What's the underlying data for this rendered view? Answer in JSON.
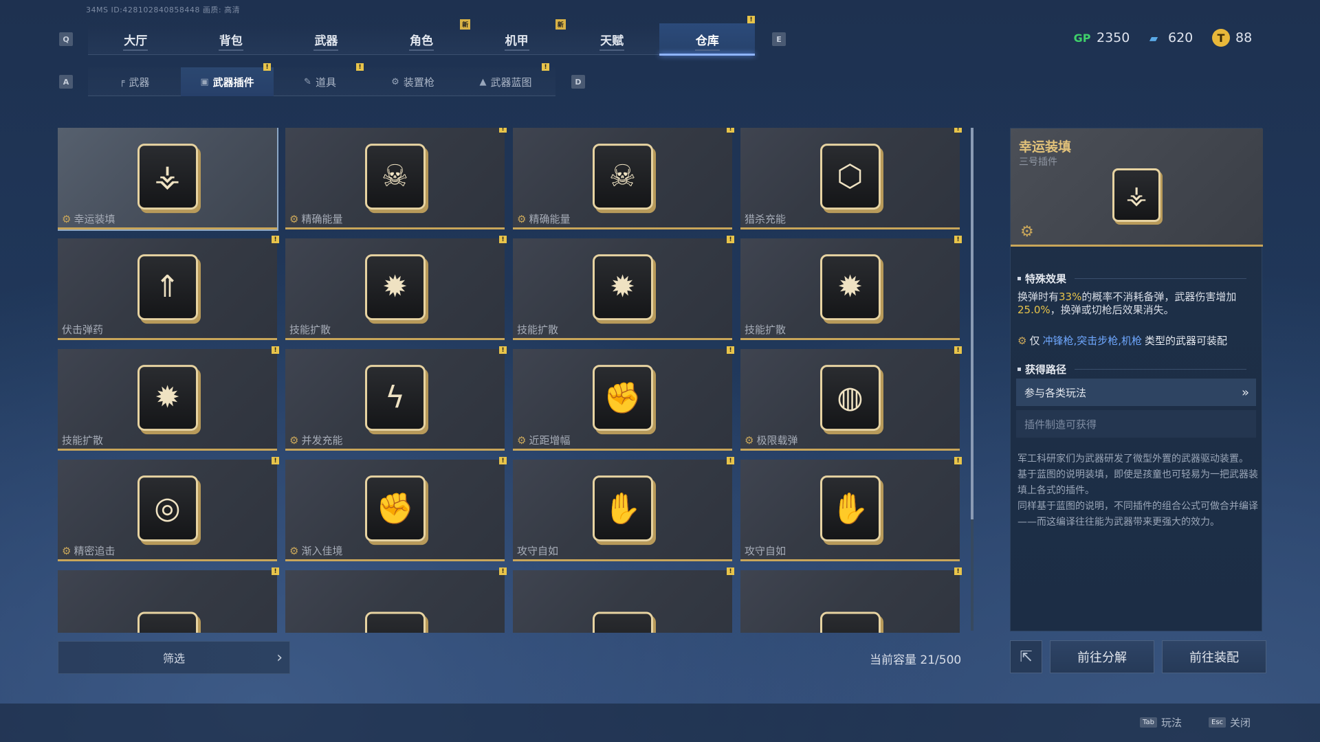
{
  "sysinfo": "34MS  ID:428102840858448    画质: 高清",
  "keys": {
    "prev_tab": "Q",
    "next_tab": "E",
    "prev_sub": "A",
    "next_sub": "D"
  },
  "tabs": [
    {
      "label": "大厅"
    },
    {
      "label": "背包"
    },
    {
      "label": "武器"
    },
    {
      "label": "角色",
      "badge": "新"
    },
    {
      "label": "机甲",
      "badge": "新"
    },
    {
      "label": "天赋"
    },
    {
      "label": "仓库",
      "active": true,
      "mark": "!"
    }
  ],
  "currency": [
    {
      "icon": "gp-icon",
      "symbol": "GP",
      "value": "2350",
      "color": "#3fd06a"
    },
    {
      "icon": "ticket-icon",
      "symbol": "▰",
      "value": "620",
      "color": "#5aa9e6"
    },
    {
      "icon": "coin-icon",
      "symbol": "T",
      "value": "88",
      "color": "#e8b83a"
    }
  ],
  "subtabs": [
    {
      "label": "武器",
      "icon": "rifle-icon",
      "glyph": "╒"
    },
    {
      "label": "武器插件",
      "icon": "plugin-icon",
      "glyph": "▣",
      "active": true,
      "mark": "!"
    },
    {
      "label": "道具",
      "icon": "item-icon",
      "glyph": "✎",
      "mark": "!"
    },
    {
      "label": "装置枪",
      "icon": "device-gun-icon",
      "glyph": "⚙"
    },
    {
      "label": "武器蓝图",
      "icon": "blueprint-icon",
      "glyph": "▲",
      "mark": "!"
    }
  ],
  "cards": [
    {
      "label": "幸运装填",
      "gear": true,
      "glyph": "⚶",
      "selected": true
    },
    {
      "label": "精确能量",
      "gear": true,
      "glyph": "☠",
      "mark": true
    },
    {
      "label": "精确能量",
      "gear": true,
      "glyph": "☠",
      "mark": true
    },
    {
      "label": "猎杀充能",
      "gear": false,
      "glyph": "⬡",
      "mark": true
    },
    {
      "label": "伏击弹药",
      "gear": false,
      "glyph": "⇑",
      "mark": true
    },
    {
      "label": "技能扩散",
      "gear": false,
      "glyph": "✹",
      "mark": true
    },
    {
      "label": "技能扩散",
      "gear": false,
      "glyph": "✹",
      "mark": true
    },
    {
      "label": "技能扩散",
      "gear": false,
      "glyph": "✹",
      "mark": true
    },
    {
      "label": "技能扩散",
      "gear": false,
      "glyph": "✹",
      "mark": true
    },
    {
      "label": "并发充能",
      "gear": true,
      "glyph": "ϟ",
      "mark": true
    },
    {
      "label": "近距增幅",
      "gear": true,
      "glyph": "✊",
      "mark": true
    },
    {
      "label": "极限载弹",
      "gear": true,
      "glyph": "◍",
      "mark": true
    },
    {
      "label": "精密追击",
      "gear": true,
      "glyph": "◎",
      "mark": true
    },
    {
      "label": "渐入佳境",
      "gear": true,
      "glyph": "✊",
      "mark": true
    },
    {
      "label": "攻守自如",
      "gear": false,
      "glyph": "✋",
      "mark": true
    },
    {
      "label": "攻守自如",
      "gear": false,
      "glyph": "✋",
      "mark": true
    },
    {
      "label": "",
      "gear": false,
      "glyph": "⚡",
      "mark": true
    },
    {
      "label": "",
      "gear": false,
      "glyph": "⚡",
      "mark": true
    },
    {
      "label": "",
      "gear": false,
      "glyph": "▤",
      "mark": true
    },
    {
      "label": "",
      "gear": false,
      "glyph": "✦",
      "mark": true
    }
  ],
  "filter_label": "筛选",
  "capacity": "当前容量 21/500",
  "detail": {
    "title": "幸运装填",
    "subtitle": "三号插件",
    "section_effect": "特殊效果",
    "effect_pre": "换弹时有",
    "effect_pct": "33%",
    "effect_mid": "的概率不消耗备弹，武器伤害增加",
    "effect_val": "25.0%",
    "effect_post": "，换弹或切枪后效果消失。",
    "only_pre": "仅",
    "only_types": "冲锋枪,突击步枪,机枪",
    "only_post": "类型的武器可装配",
    "section_route": "获得路径",
    "route1": "参与各类玩法",
    "route2": "插件制造可获得",
    "lore": "军工科研家们为武器研发了微型外置的武器驱动装置。\n基于蓝图的说明装填，即使是孩童也可轻易为一把武器装填上各式的插件。\n同样基于蓝图的说明，不同插件的组合公式可做合并编译——而这编译往往能为武器带来更强大的效力。"
  },
  "actions": {
    "disassemble": "前往分解",
    "equip": "前往装配"
  },
  "hints": [
    {
      "key": "Tab",
      "label": "玩法"
    },
    {
      "key": "Esc",
      "label": "关闭"
    }
  ]
}
